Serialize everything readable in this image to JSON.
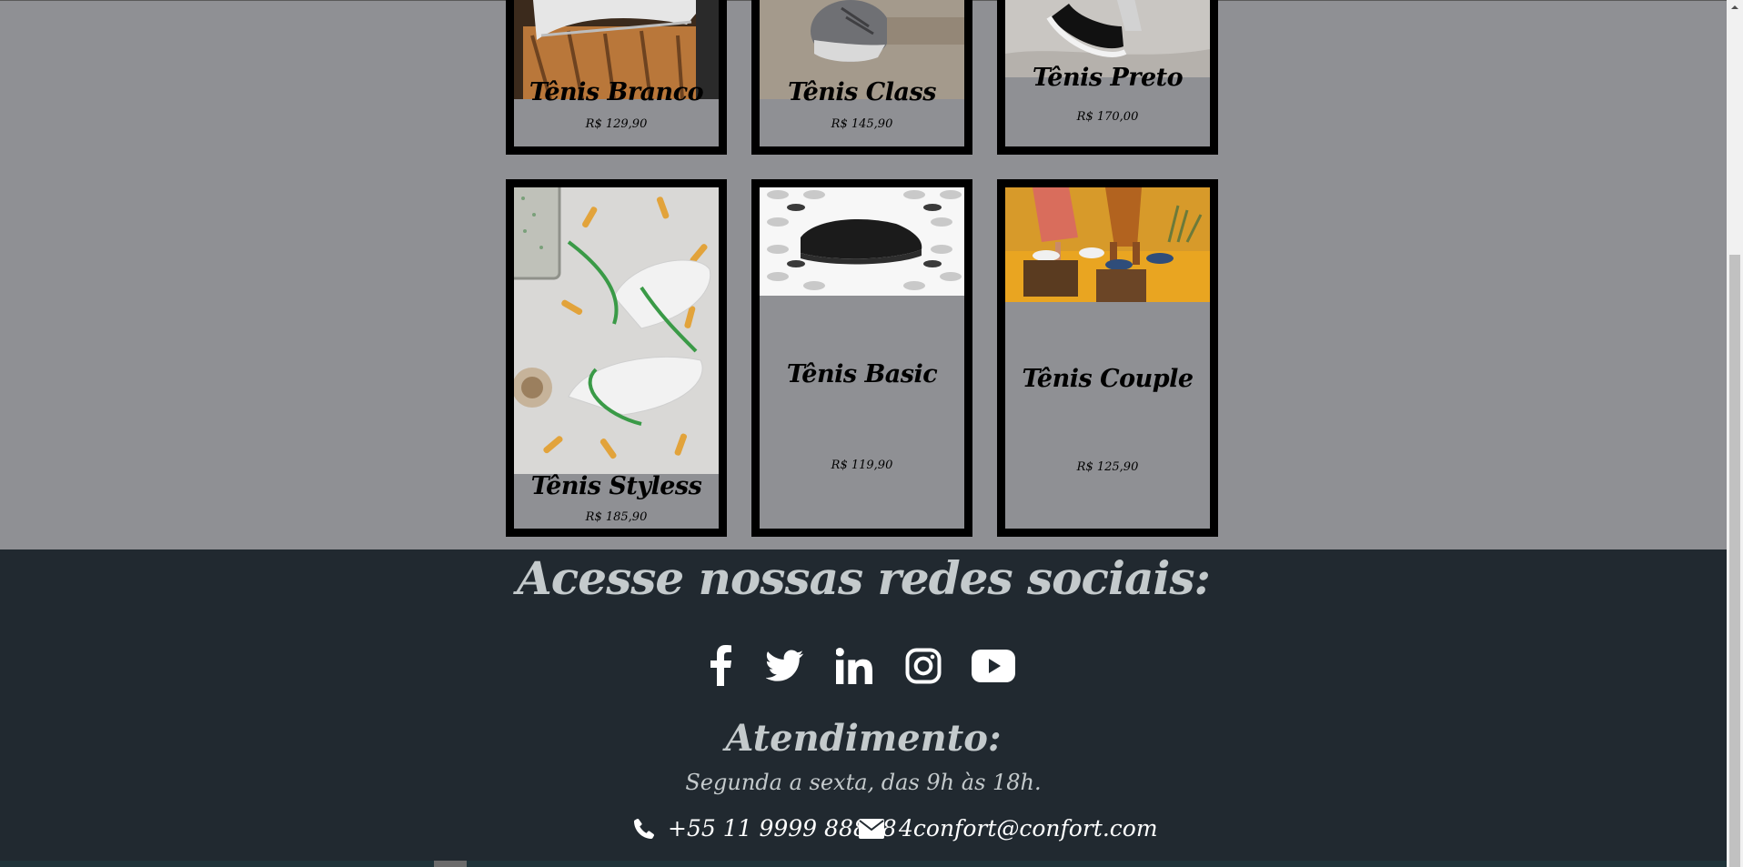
{
  "products": [
    {
      "name": "Tênis Branco",
      "price": "R$ 129,90",
      "image": "white sneaker on wooden stump"
    },
    {
      "name": "Tênis Class",
      "price": "R$ 145,90",
      "image": "grey knit sneaker"
    },
    {
      "name": "Tênis Preto",
      "price": "R$ 170,00",
      "image": "black sneaker on foot"
    },
    {
      "name": "Tênis Styless",
      "price": "R$ 185,90",
      "image": "white sneakers with green laces"
    },
    {
      "name": "Tênis Basic",
      "price": "R$ 119,90",
      "image": "black sneaker on white pattern"
    },
    {
      "name": "Tênis Couple",
      "price": "R$ 125,90",
      "image": "couple wearing sneakers on yellow"
    }
  ],
  "footer": {
    "social_title": "Acesse nossas redes sociais:",
    "social_icons": [
      "facebook-icon",
      "twitter-icon",
      "linkedin-icon",
      "instagram-icon",
      "youtube-icon"
    ],
    "attendance_title": "Atendimento:",
    "attendance_hours": "Segunda a sexta, das 9h às 18h.",
    "phone": "+55 11 9999 88888",
    "email": "4confort@confort.com"
  },
  "colors": {
    "page_background": "#8f9094",
    "card_border": "#000000",
    "footer_background": "#212930",
    "footer_text": "#c4cacc"
  }
}
